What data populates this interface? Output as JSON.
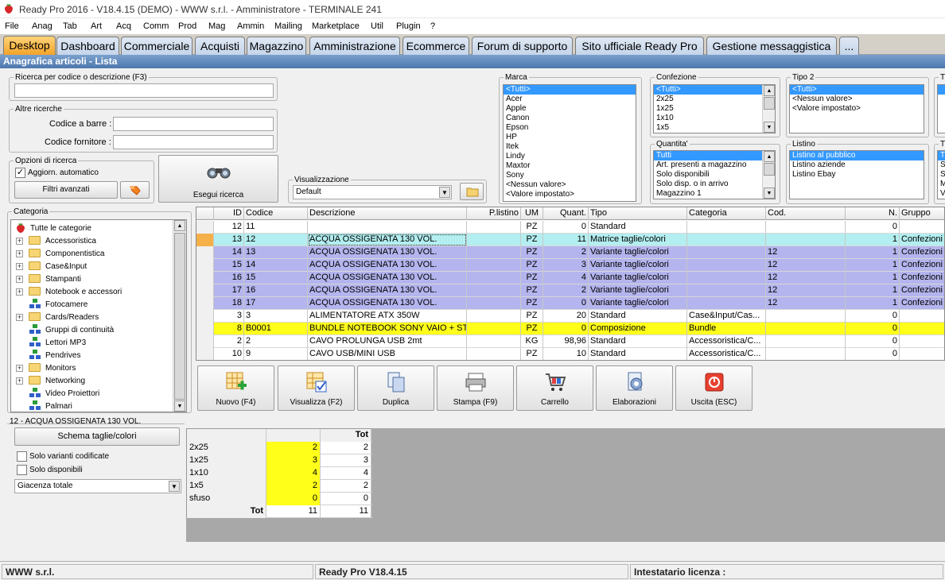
{
  "window": {
    "title": "Ready Pro 2016 - V18.4.15 (DEMO) - WWW s.r.l. - Amministratore - TERMINALE 241"
  },
  "menu": [
    "File",
    "Anag",
    "Tab",
    "Art",
    "Acq",
    "Comm",
    "Prod",
    "Mag",
    "Ammin",
    "Mailing",
    "Marketplace",
    "Util",
    "Plugin",
    "?"
  ],
  "tabs": [
    "Desktop",
    "Dashboard",
    "Commerciale",
    "Acquisti",
    "Magazzino",
    "Amministrazione",
    "Ecommerce",
    "Forum di supporto",
    "Sito ufficiale Ready Pro",
    "Gestione messaggistica",
    "..."
  ],
  "header": "Anagrafica articoli  - Lista",
  "search": {
    "legend": "Ricerca per codice o descrizione (F3)",
    "value": "",
    "other_legend": "Altre ricerche",
    "barcode_label": "Codice a barre :",
    "supplier_label": "Codice fornitore :",
    "options_legend": "Opzioni di ricerca",
    "auto_update_label": "Aggiorn. automatico",
    "advanced_filters": "Filtri avanzati",
    "execute": "Esegui ricerca"
  },
  "view": {
    "legend": "Visualizzazione",
    "value": "Default"
  },
  "filters": {
    "marca": {
      "legend": "Marca",
      "items": [
        "<Tutti>",
        "Acer",
        "Apple",
        "Canon",
        "Epson",
        "HP",
        "Itek",
        "Lindy",
        "Maxtor",
        "Sony",
        "<Nessun valore>",
        "<Valore impostato>"
      ]
    },
    "confezione": {
      "legend": "Confezione",
      "items": [
        "<Tutti>",
        "2x25",
        "1x25",
        "1x10",
        "1x5"
      ]
    },
    "tipo2": {
      "legend": "Tipo 2",
      "items": [
        "<Tutti>",
        "<Nessun valore>",
        "<Valore impostato>"
      ]
    },
    "quantita": {
      "legend": "Quantita'",
      "items": [
        "Tutti",
        "Art. presenti a magazzino",
        "Solo disponibili",
        "Solo disp. o in arrivo",
        "Magazzino 1"
      ]
    },
    "listino": {
      "legend": "Listino",
      "items": [
        "Listino al pubblico",
        "Listino aziende",
        "Listino Ebay"
      ]
    },
    "extra_legend_1": "T",
    "extra_legend_2": "T",
    "extra_items_2": [
      "T",
      "S",
      "S",
      "M",
      "V"
    ]
  },
  "categories": {
    "legend": "Categoria",
    "items": [
      {
        "label": "Tutte le categorie",
        "kind": "root"
      },
      {
        "label": "Accessoristica",
        "kind": "folder"
      },
      {
        "label": "Componentistica",
        "kind": "folder"
      },
      {
        "label": "Case&Input",
        "kind": "folder"
      },
      {
        "label": "Stampanti",
        "kind": "folder"
      },
      {
        "label": "Notebook e accessori",
        "kind": "folder"
      },
      {
        "label": "Fotocamere",
        "kind": "leaf"
      },
      {
        "label": "Cards/Readers",
        "kind": "folder"
      },
      {
        "label": "Gruppi di continuità",
        "kind": "leaf"
      },
      {
        "label": "Lettori MP3",
        "kind": "leaf"
      },
      {
        "label": "Pendrives",
        "kind": "leaf"
      },
      {
        "label": "Monitors",
        "kind": "folder"
      },
      {
        "label": "Networking",
        "kind": "folder"
      },
      {
        "label": "Video Proiettori",
        "kind": "leaf"
      },
      {
        "label": "Palmari",
        "kind": "leaf"
      }
    ]
  },
  "grid": {
    "columns": [
      "ID",
      "Codice",
      "Descrizione",
      "P.listino",
      "UM",
      "Quant.",
      "Tipo",
      "Categoria",
      "Cod.",
      "N.",
      "Gruppo"
    ],
    "rows": [
      {
        "id": "12",
        "codice": "11",
        "desc": "",
        "plistino": "",
        "um": "PZ",
        "quant": "0",
        "tipo": "Standard",
        "cat": "",
        "cod": "",
        "n": "0",
        "gruppo": "",
        "style": "white"
      },
      {
        "id": "13",
        "codice": "12",
        "desc": "ACQUA OSSIGENATA 130 VOL.",
        "plistino": "",
        "um": "PZ",
        "quant": "11",
        "tipo": "Matrice taglie/colori",
        "cat": "",
        "cod": "",
        "n": "1",
        "gruppo": "Confezioni",
        "style": "cyan"
      },
      {
        "id": "14",
        "codice": "13",
        "desc": "ACQUA OSSIGENATA 130 VOL.",
        "plistino": "",
        "um": "PZ",
        "quant": "2",
        "tipo": "Variante taglie/colori",
        "cat": "",
        "cod": "12",
        "n": "1",
        "gruppo": "Confezioni",
        "style": "lav"
      },
      {
        "id": "15",
        "codice": "14",
        "desc": "ACQUA OSSIGENATA 130 VOL.",
        "plistino": "",
        "um": "PZ",
        "quant": "3",
        "tipo": "Variante taglie/colori",
        "cat": "",
        "cod": "12",
        "n": "1",
        "gruppo": "Confezioni",
        "style": "lav"
      },
      {
        "id": "16",
        "codice": "15",
        "desc": "ACQUA OSSIGENATA 130 VOL.",
        "plistino": "",
        "um": "PZ",
        "quant": "4",
        "tipo": "Variante taglie/colori",
        "cat": "",
        "cod": "12",
        "n": "1",
        "gruppo": "Confezioni",
        "style": "lav"
      },
      {
        "id": "17",
        "codice": "16",
        "desc": "ACQUA OSSIGENATA 130 VOL.",
        "plistino": "",
        "um": "PZ",
        "quant": "2",
        "tipo": "Variante taglie/colori",
        "cat": "",
        "cod": "12",
        "n": "1",
        "gruppo": "Confezioni",
        "style": "lav"
      },
      {
        "id": "18",
        "codice": "17",
        "desc": "ACQUA OSSIGENATA 130 VOL.",
        "plistino": "",
        "um": "PZ",
        "quant": "0",
        "tipo": "Variante taglie/colori",
        "cat": "",
        "cod": "12",
        "n": "1",
        "gruppo": "Confezioni",
        "style": "lav"
      },
      {
        "id": "3",
        "codice": "3",
        "desc": "ALIMENTATORE ATX 350W",
        "plistino": "",
        "um": "PZ",
        "quant": "20",
        "tipo": "Standard",
        "cat": "Case&Input/Cas...",
        "cod": "",
        "n": "0",
        "gruppo": "",
        "style": "white"
      },
      {
        "id": "8",
        "codice": "B0001",
        "desc": "BUNDLE NOTEBOOK SONY VAIO + ST...",
        "plistino": "",
        "um": "PZ",
        "quant": "0",
        "tipo": "Composizione",
        "cat": "Bundle",
        "cod": "",
        "n": "0",
        "gruppo": "",
        "style": "yellow"
      },
      {
        "id": "2",
        "codice": "2",
        "desc": "CAVO PROLUNGA USB 2mt",
        "plistino": "",
        "um": "KG",
        "quant": "98,96",
        "tipo": "Standard",
        "cat": "Accessoristica/C...",
        "cod": "",
        "n": "0",
        "gruppo": "",
        "style": "white"
      },
      {
        "id": "10",
        "codice": "9",
        "desc": "CAVO USB/MINI USB",
        "plistino": "",
        "um": "PZ",
        "quant": "10",
        "tipo": "Standard",
        "cat": "Accessoristica/C...",
        "cod": "",
        "n": "0",
        "gruppo": "",
        "style": "white"
      }
    ]
  },
  "actions": [
    "Nuovo (F4)",
    "Visualizza (F2)",
    "Duplica",
    "Stampa (F9)",
    "Carrello",
    "Elaborazioni",
    "Uscita (ESC)"
  ],
  "detail": {
    "title": "12 - ACQUA OSSIGENATA 130 VOL.",
    "scheme_button": "Schema taglie/colori",
    "only_coded": "Solo varianti codificate",
    "only_available": "Solo disponibili",
    "stock_select": "Giacenza totale"
  },
  "matrix": {
    "header_tot": "Tot",
    "rows": [
      {
        "label": "2x25",
        "val": "2",
        "tot": "2"
      },
      {
        "label": "1x25",
        "val": "3",
        "tot": "3"
      },
      {
        "label": "1x10",
        "val": "4",
        "tot": "4"
      },
      {
        "label": "1x5",
        "val": "2",
        "tot": "2"
      },
      {
        "label": "sfuso",
        "val": "0",
        "tot": "0"
      }
    ],
    "footer_label": "Tot",
    "footer_val": "11",
    "footer_tot": "11"
  },
  "status": [
    "WWW s.r.l.",
    "Ready Pro V18.4.15",
    "Intestatario licenza :"
  ],
  "colors": {
    "cyan": "#b3eef0",
    "lav": "#b4b4ee",
    "yellow": "#ffff1a",
    "white": "#ffffff",
    "accent": "#f3a428"
  }
}
